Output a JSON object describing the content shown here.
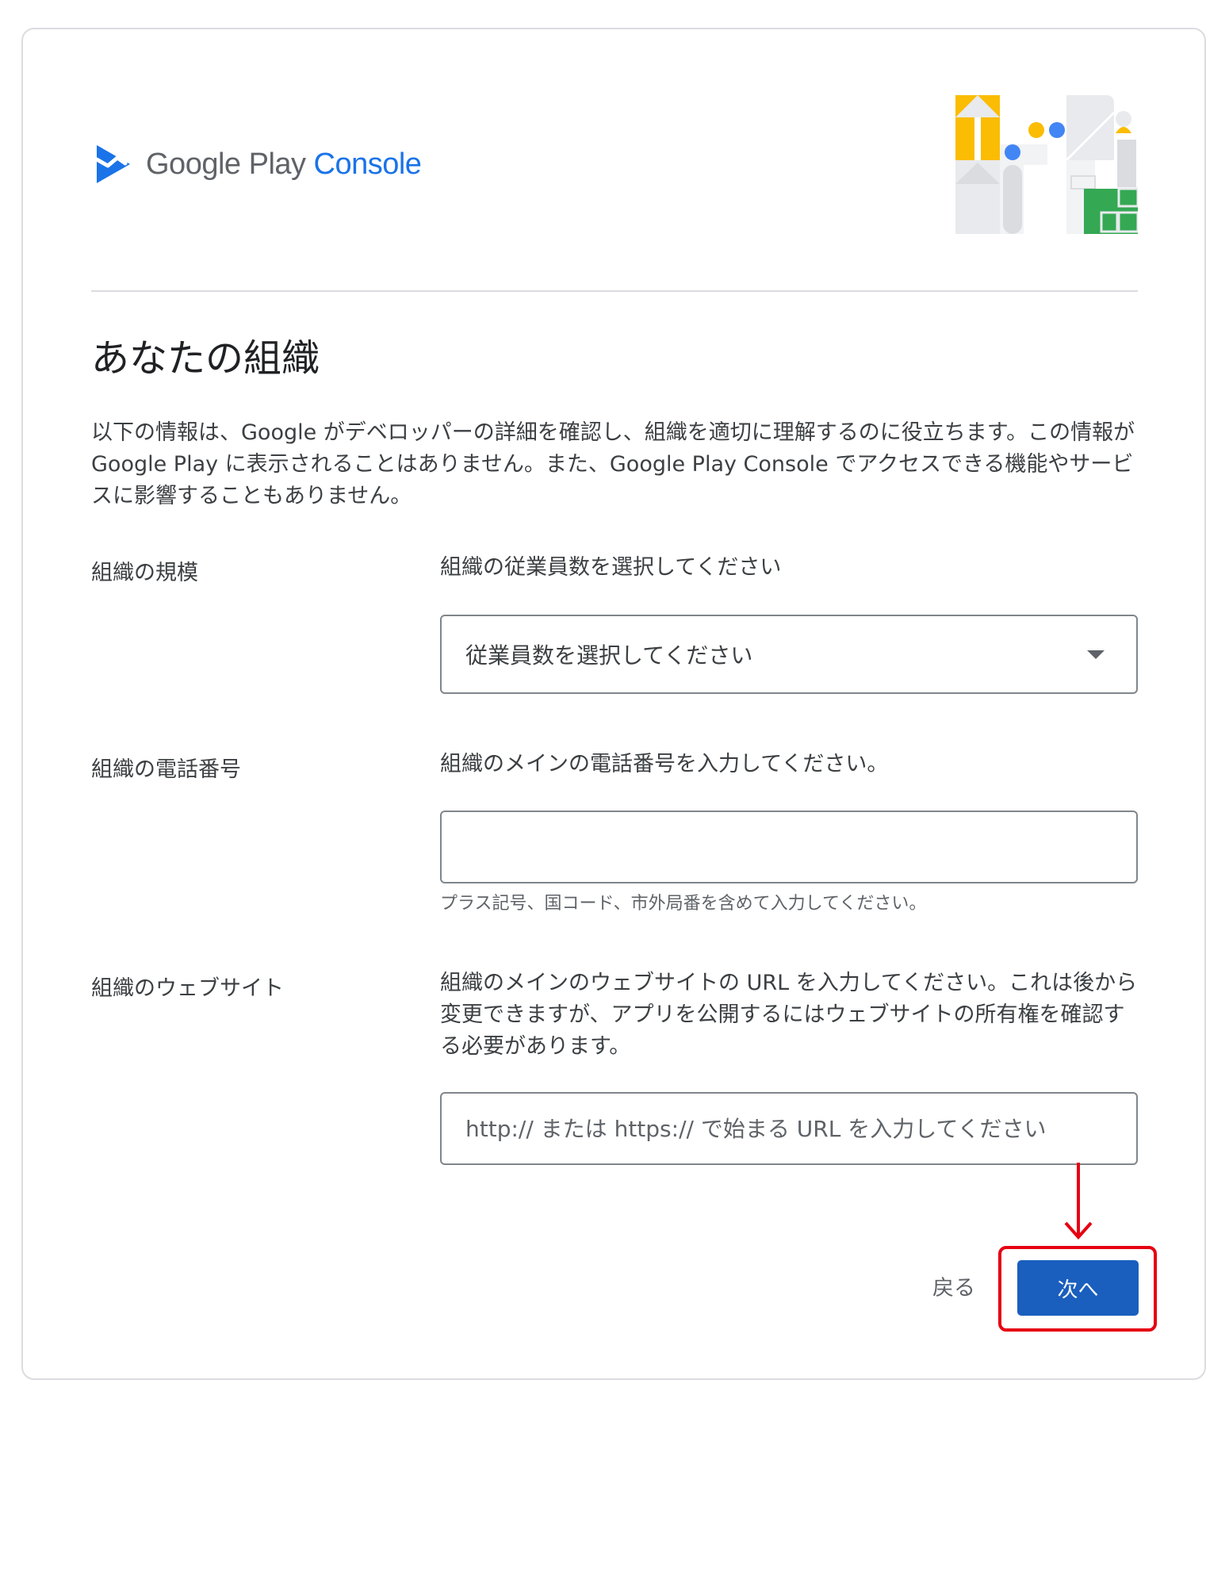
{
  "header": {
    "brand_google_play": "Google Play",
    "brand_console": "Console"
  },
  "page": {
    "title": "あなたの組織",
    "intro": "以下の情報は、Google がデベロッパーの詳細を確認し、組織を適切に理解するのに役立ちます。この情報が Google Play に表示されることはありません。また、Google Play Console でアクセスできる機能やサービスに影響することもありません。"
  },
  "org_size": {
    "label": "組織の規模",
    "description": "組織の従業員数を選択してください",
    "select_value": "従業員数を選択してください"
  },
  "org_phone": {
    "label": "組織の電話番号",
    "description": "組織のメインの電話番号を入力してください。",
    "value": "",
    "helper": "プラス記号、国コード、市外局番を含めて入力してください。"
  },
  "org_website": {
    "label": "組織のウェブサイト",
    "description": "組織のメインのウェブサイトの URL を入力してください。これは後から変更できますが、アプリを公開するにはウェブサイトの所有権を確認する必要があります。",
    "value": "",
    "placeholder": "http:// または https:// で始まる URL を入力してください"
  },
  "actions": {
    "back_label": "戻る",
    "next_label": "次へ"
  },
  "colors": {
    "primary": "#1a5fbe",
    "brand_blue": "#1a73e8",
    "annotation_red": "#e60012"
  },
  "icons": {
    "logo": "google-play-console-logo",
    "dropdown": "caret-down-icon",
    "annotation": "red-arrow-down"
  }
}
